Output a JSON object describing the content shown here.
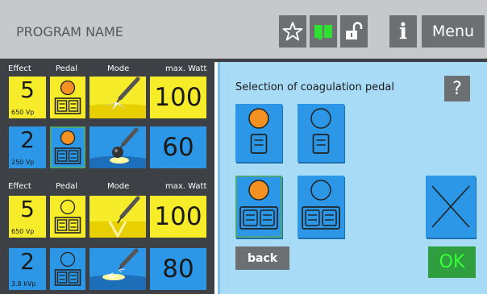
{
  "header": {
    "program_name": "PROGRAM NAME",
    "menu_label": "Menu",
    "info_label": "i",
    "icons": [
      "star-outline-icon",
      "book-icon",
      "lock-open-icon",
      "info-icon"
    ]
  },
  "columns": {
    "effect": "Effect",
    "pedal": "Pedal",
    "mode": "Mode",
    "watt": "max. Watt"
  },
  "sections": [
    {
      "rows": [
        {
          "effect": "5",
          "voltage": "650 Vp",
          "watt": "100",
          "color": "yellow",
          "pedal_filled": true
        },
        {
          "effect": "2",
          "voltage": "250 Vp",
          "watt": "60",
          "color": "blue",
          "pedal_filled": true
        }
      ]
    },
    {
      "rows": [
        {
          "effect": "5",
          "voltage": "650 Vp",
          "watt": "100",
          "color": "yellow",
          "pedal_filled": false
        },
        {
          "effect": "2",
          "voltage": "3.8 kVp",
          "watt": "80",
          "color": "blue",
          "pedal_filled": false
        }
      ]
    }
  ],
  "panel": {
    "title": "Selection of coagulation pedal",
    "help_label": "?",
    "back_label": "back",
    "ok_label": "OK",
    "cancel_icon": "close-x-icon",
    "selected_option": "orange-double"
  },
  "colors": {
    "yellow": "#f7ec2a",
    "blue": "#2b97e6",
    "orange": "#f39222",
    "panel": "#a8dbf6",
    "dark": "#3d4044",
    "button_gray": "#6d7073",
    "ok_green": "#2e9e3f"
  }
}
